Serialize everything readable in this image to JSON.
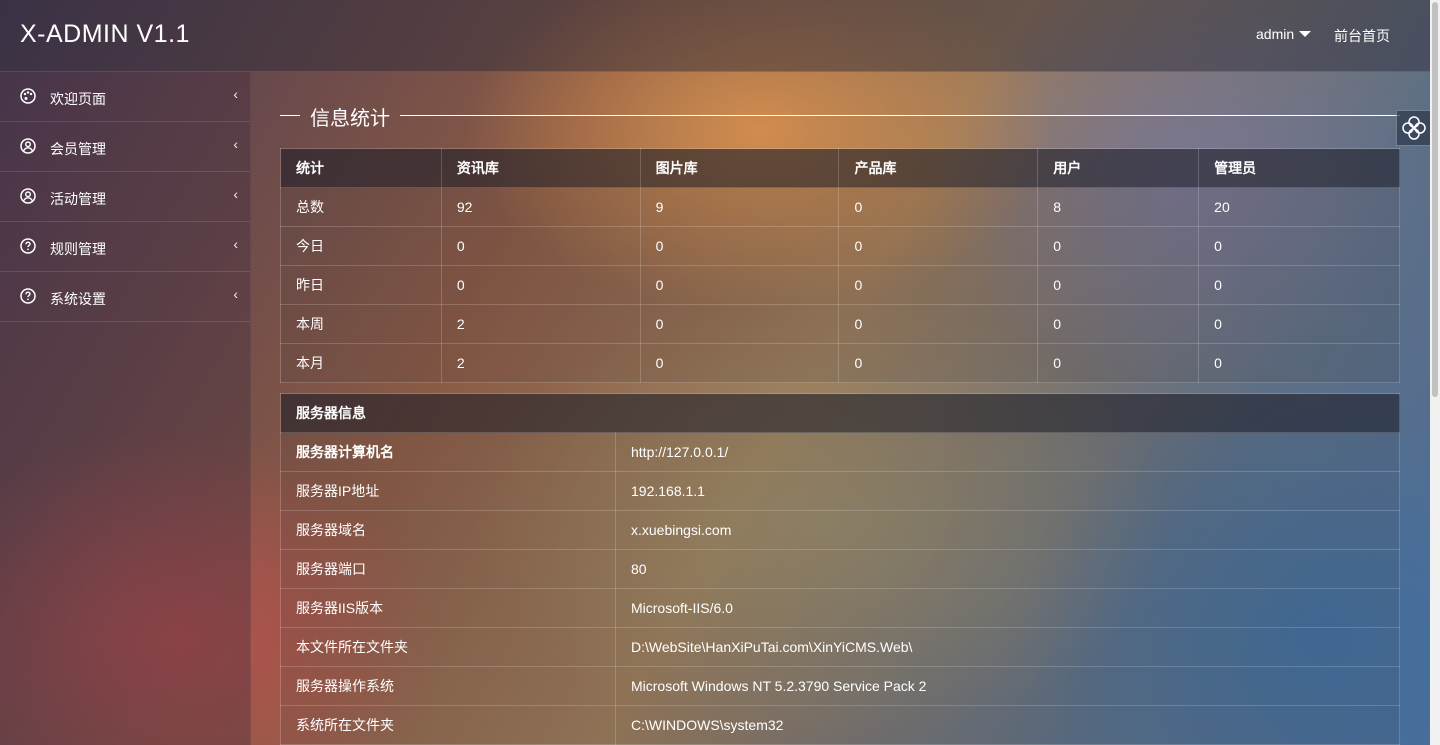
{
  "header": {
    "logo": "X-ADMIN V1.1",
    "user": "admin",
    "front_link": "前台首页"
  },
  "sidebar": {
    "items": [
      {
        "label": "欢迎页面",
        "icon": "palette-icon"
      },
      {
        "label": "会员管理",
        "icon": "user-circle-icon"
      },
      {
        "label": "活动管理",
        "icon": "user-circle-icon"
      },
      {
        "label": "规则管理",
        "icon": "question-circle-icon"
      },
      {
        "label": "系统设置",
        "icon": "question-circle-icon"
      }
    ],
    "chevron": "‹"
  },
  "main": {
    "section_title": "信息统计",
    "stats": {
      "headers": [
        "统计",
        "资讯库",
        "图片库",
        "产品库",
        "用户",
        "管理员"
      ],
      "rows": [
        [
          "总数",
          "92",
          "9",
          "0",
          "8",
          "20"
        ],
        [
          "今日",
          "0",
          "0",
          "0",
          "0",
          "0"
        ],
        [
          "昨日",
          "0",
          "0",
          "0",
          "0",
          "0"
        ],
        [
          "本周",
          "2",
          "0",
          "0",
          "0",
          "0"
        ],
        [
          "本月",
          "2",
          "0",
          "0",
          "0",
          "0"
        ]
      ]
    },
    "server": {
      "title": "服务器信息",
      "rows": [
        [
          "服务器计算机名",
          "http://127.0.0.1/"
        ],
        [
          "服务器IP地址",
          "192.168.1.1"
        ],
        [
          "服务器域名",
          "x.xuebingsi.com"
        ],
        [
          "服务器端口",
          "80"
        ],
        [
          "服务器IIS版本",
          "Microsoft-IIS/6.0"
        ],
        [
          "本文件所在文件夹",
          "D:\\WebSite\\HanXiPuTai.com\\XinYiCMS.Web\\"
        ],
        [
          "服务器操作系统",
          "Microsoft Windows NT 5.2.3790 Service Pack 2"
        ],
        [
          "系统所在文件夹",
          "C:\\WINDOWS\\system32"
        ]
      ]
    }
  },
  "colors": {
    "header_bg": "#3a3a4a",
    "text": "#ffffff"
  }
}
